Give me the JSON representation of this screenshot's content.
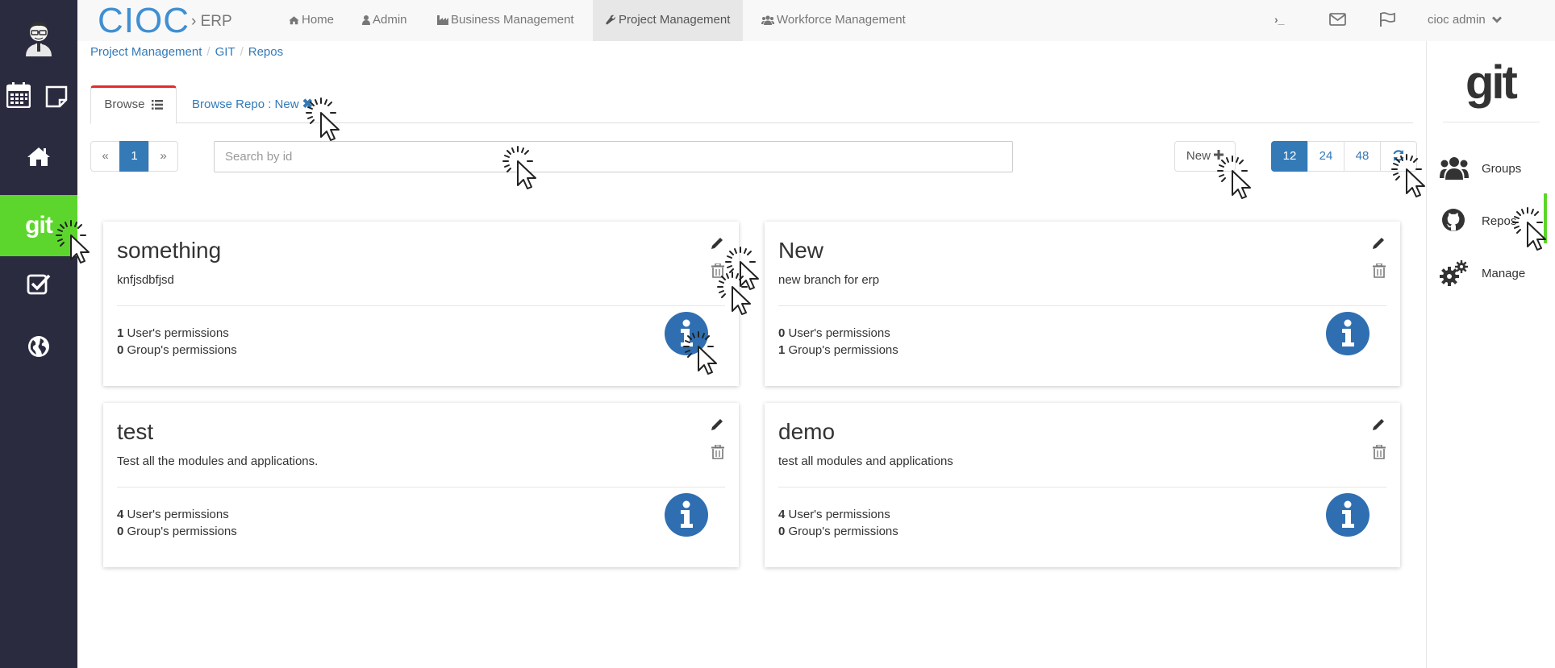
{
  "brand": {
    "name": "CIOC",
    "sub": "› ERP"
  },
  "nav": {
    "items": [
      {
        "label": "Home",
        "icon": "home-icon"
      },
      {
        "label": "Admin",
        "icon": "user-icon"
      },
      {
        "label": "Business Management",
        "icon": "industry-icon"
      },
      {
        "label": "Project Management",
        "icon": "wrench-icon"
      },
      {
        "label": "Workforce Management",
        "icon": "users-icon"
      }
    ],
    "terminal": "›_",
    "user": "cioc admin"
  },
  "sidebar": {
    "git_label": "git"
  },
  "breadcrumb": [
    "Project Management",
    "GIT",
    "Repos"
  ],
  "tabs": {
    "browse": "Browse",
    "repo": "Browse Repo : New",
    "close": "✖"
  },
  "pager": {
    "prev": "«",
    "page": "1",
    "next": "»"
  },
  "search": {
    "placeholder": "Search by id"
  },
  "new_button": "New",
  "page_sizes": [
    "12",
    "24",
    "48"
  ],
  "repos": [
    {
      "title": "something",
      "description": "knfjsdbfjsd",
      "users": "1",
      "users_label": "User's permissions",
      "groups": "0",
      "groups_label": "Group's permissions"
    },
    {
      "title": "New",
      "description": "new branch for erp",
      "users": "0",
      "users_label": "User's permissions",
      "groups": "1",
      "groups_label": "Group's permissions"
    },
    {
      "title": "test",
      "description": "Test all the modules and applications.",
      "users": "4",
      "users_label": "User's permissions",
      "groups": "0",
      "groups_label": "Group's permissions"
    },
    {
      "title": "demo",
      "description": "test all modules and applications",
      "users": "4",
      "users_label": "User's permissions",
      "groups": "0",
      "groups_label": "Group's permissions"
    }
  ],
  "right_panel": {
    "logo": "git",
    "items": [
      {
        "label": "Groups",
        "icon": "users-icon"
      },
      {
        "label": "Repos",
        "icon": "github-icon"
      },
      {
        "label": "Manage",
        "icon": "gears-icon"
      }
    ]
  },
  "colors": {
    "accent_green": "#5cd62c",
    "primary_blue": "#337ab7",
    "sidebar_bg": "#2b2b40",
    "tab_red": "#e02d2d"
  }
}
